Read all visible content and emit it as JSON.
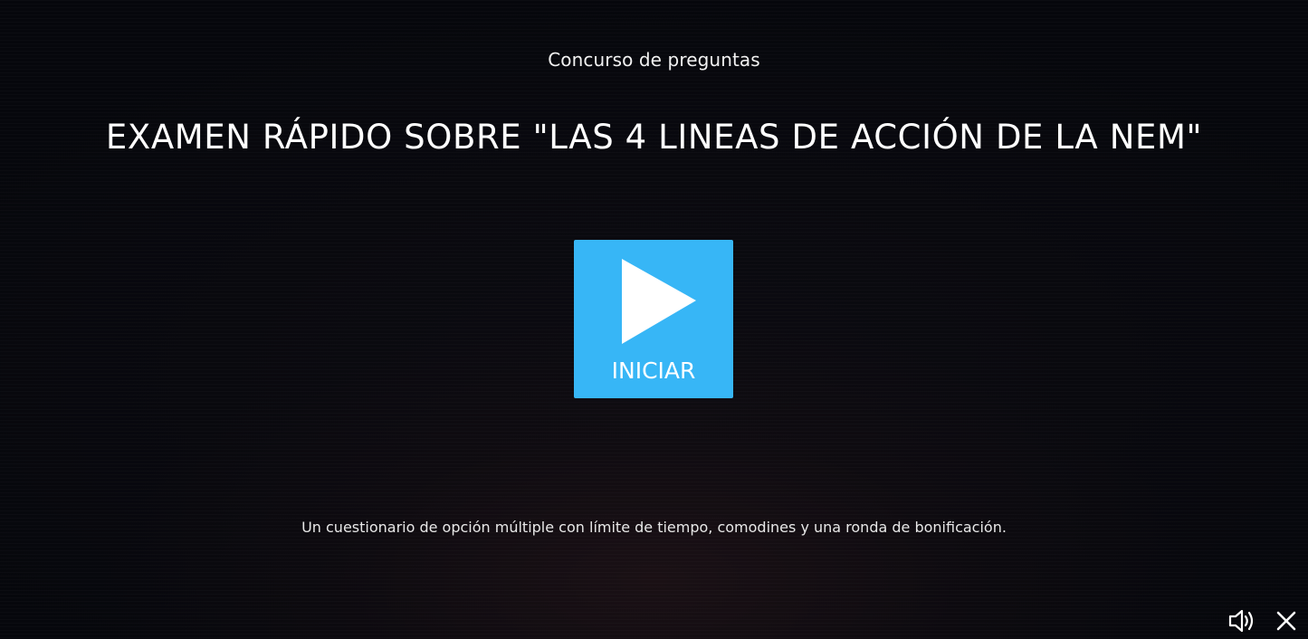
{
  "quiz": {
    "category": "Concurso de preguntas",
    "title": "EXAMEN RÁPIDO SOBRE \"LAS 4 LINEAS DE ACCIÓN DE LA NEM\"",
    "start_label": "INICIAR",
    "description": "Un cuestionario de opción múltiple con límite de tiempo, comodines y una ronda de bonificación."
  },
  "controls": {
    "sound_icon": "speaker-volume-icon",
    "close_icon": "close-icon"
  },
  "colors": {
    "background": "#06070c",
    "accent": "#37b6f6",
    "text": "#ffffff"
  }
}
